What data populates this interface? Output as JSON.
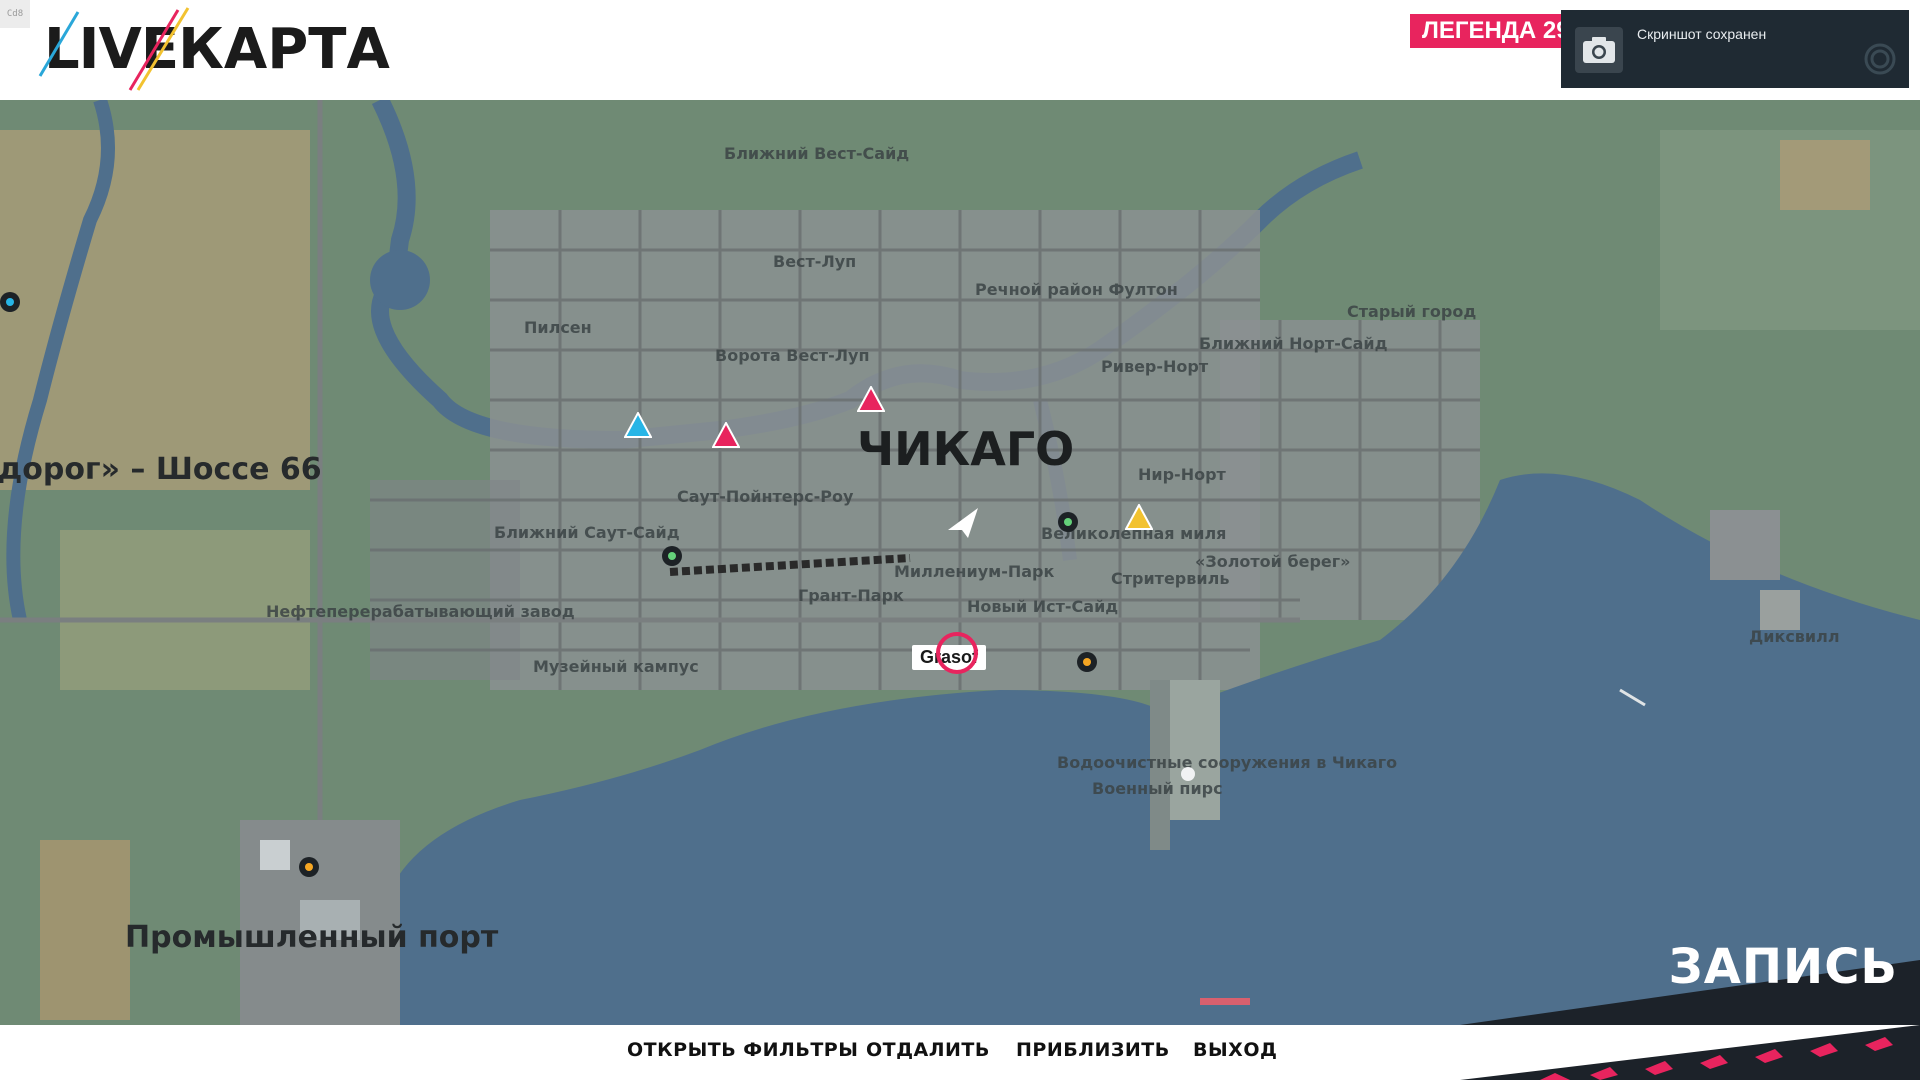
{
  "header": {
    "fps_label": "Cd8",
    "logo_live": "LIVE",
    "logo_karta": "КАРТА",
    "legend_badge": "ЛЕГЕНДА 29"
  },
  "toast": {
    "text": "Скриншот сохранен",
    "icon": "camera-icon"
  },
  "map": {
    "city_label": "ЧИКАГО",
    "big_labels": {
      "route66": "дорог» – Шоссе 66",
      "port": "Промышленный порт"
    },
    "districts": [
      "Ближний Вест-Сайд",
      "Вест-Луп",
      "Речной район Фултон",
      "Старый город",
      "Пилсен",
      "Ближний Норт-Сайд",
      "Ворота Вест-Луп",
      "Ривер-Норт",
      "Нир-Норт",
      "Саут-Пойнтерс-Роу",
      "Ближний Саут-Сайд",
      "Великолепная миля",
      "«Золотой берег»",
      "Стритервиль",
      "Нефтеперерабатывающий завод",
      "Грант-Парк",
      "Новый Ист-Сайд",
      "Музейный кампус",
      "Диксвилл",
      "Водоочистные сооружения в Чикаго",
      "Военный пирс",
      "Миллениум-Парк"
    ],
    "player_name": "Grasof",
    "recording_label": "ЗАПИСЬ",
    "colors": {
      "water": "#4f6f8c",
      "land": "#6f8a74",
      "accent": "#e8245e",
      "roads": "#8a8f90"
    }
  },
  "bottom_bar": {
    "open_filters": "ОТКРЫТЬ ФИЛЬТРЫ",
    "zoom_out": "ОТДАЛИТЬ",
    "zoom_in": "ПРИБЛИЗИТЬ",
    "exit": "ВЫХОД"
  }
}
